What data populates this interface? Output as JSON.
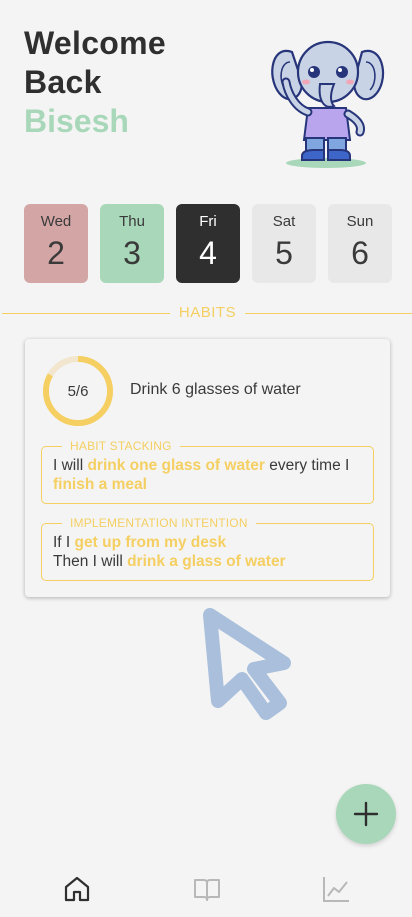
{
  "header": {
    "welcome_line1": "Welcome",
    "welcome_line2": "Back",
    "username": "Bisesh"
  },
  "days": [
    {
      "name": "Wed",
      "num": "2",
      "state": "missed"
    },
    {
      "name": "Thu",
      "num": "3",
      "state": "done"
    },
    {
      "name": "Fri",
      "num": "4",
      "state": "today"
    },
    {
      "name": "Sat",
      "num": "5",
      "state": "future"
    },
    {
      "name": "Sun",
      "num": "6",
      "state": "future"
    }
  ],
  "section": {
    "label": "HABITS"
  },
  "habit": {
    "progress_text": "5/6",
    "progress_fraction": 0.833,
    "title": "Drink 6 glasses of water",
    "stacking": {
      "legend": "HABIT STACKING",
      "prefix": "I will ",
      "action": "drink one glass of water",
      "middle": " every time I ",
      "trigger": "finish a meal"
    },
    "implementation": {
      "legend": "IMPLEMENTATION INTENTION",
      "prefix": "If I ",
      "cue": "get up from my desk",
      "then_prefix": "Then I will ",
      "action": "drink a glass of water"
    }
  },
  "fab": {
    "icon": "plus-icon"
  },
  "nav": {
    "items": [
      {
        "icon": "home-icon",
        "active": true
      },
      {
        "icon": "book-icon",
        "active": false
      },
      {
        "icon": "chart-icon",
        "active": false
      }
    ]
  },
  "colors": {
    "accent_green": "#a8d8b9",
    "accent_red": "#d4a5a5",
    "accent_yellow": "#f5cf62",
    "dark": "#2f2f2f",
    "cursor_blue": "#a9bfdc"
  }
}
